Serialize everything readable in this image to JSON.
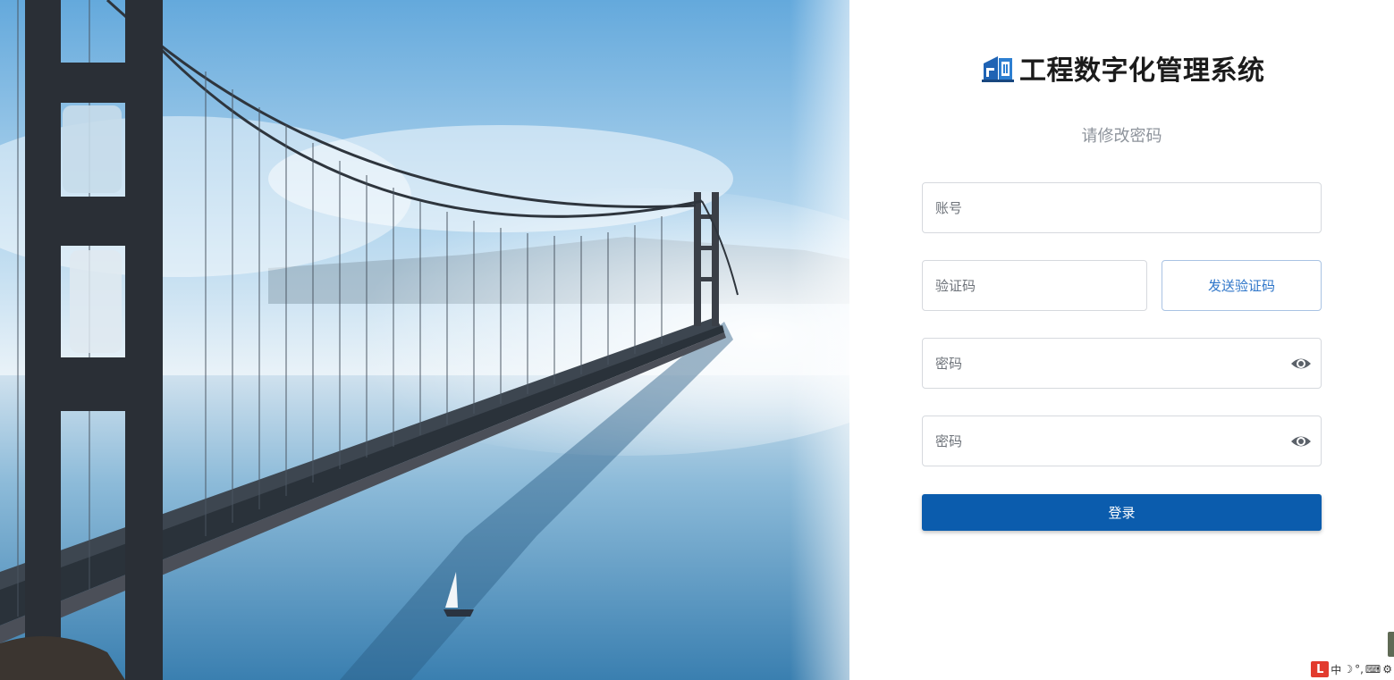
{
  "app": {
    "title": "工程数字化管理系统"
  },
  "form": {
    "subtitle": "请修改密码",
    "account_placeholder": "账号",
    "code_placeholder": "验证码",
    "send_code_label": "发送验证码",
    "password_placeholder": "密码",
    "confirm_password_placeholder": "密码",
    "submit_label": "登录"
  },
  "ime": {
    "mode": "中",
    "moon": "☽",
    "punct": "°,",
    "keyboard": "⌨",
    "settings": "⚙"
  },
  "icons": {
    "logo": "company-logo",
    "eye": "eye-icon"
  },
  "colors": {
    "primary": "#0b5cad",
    "link": "#2f76c9",
    "border": "#d6d9de",
    "subtitle": "#8d939b"
  }
}
